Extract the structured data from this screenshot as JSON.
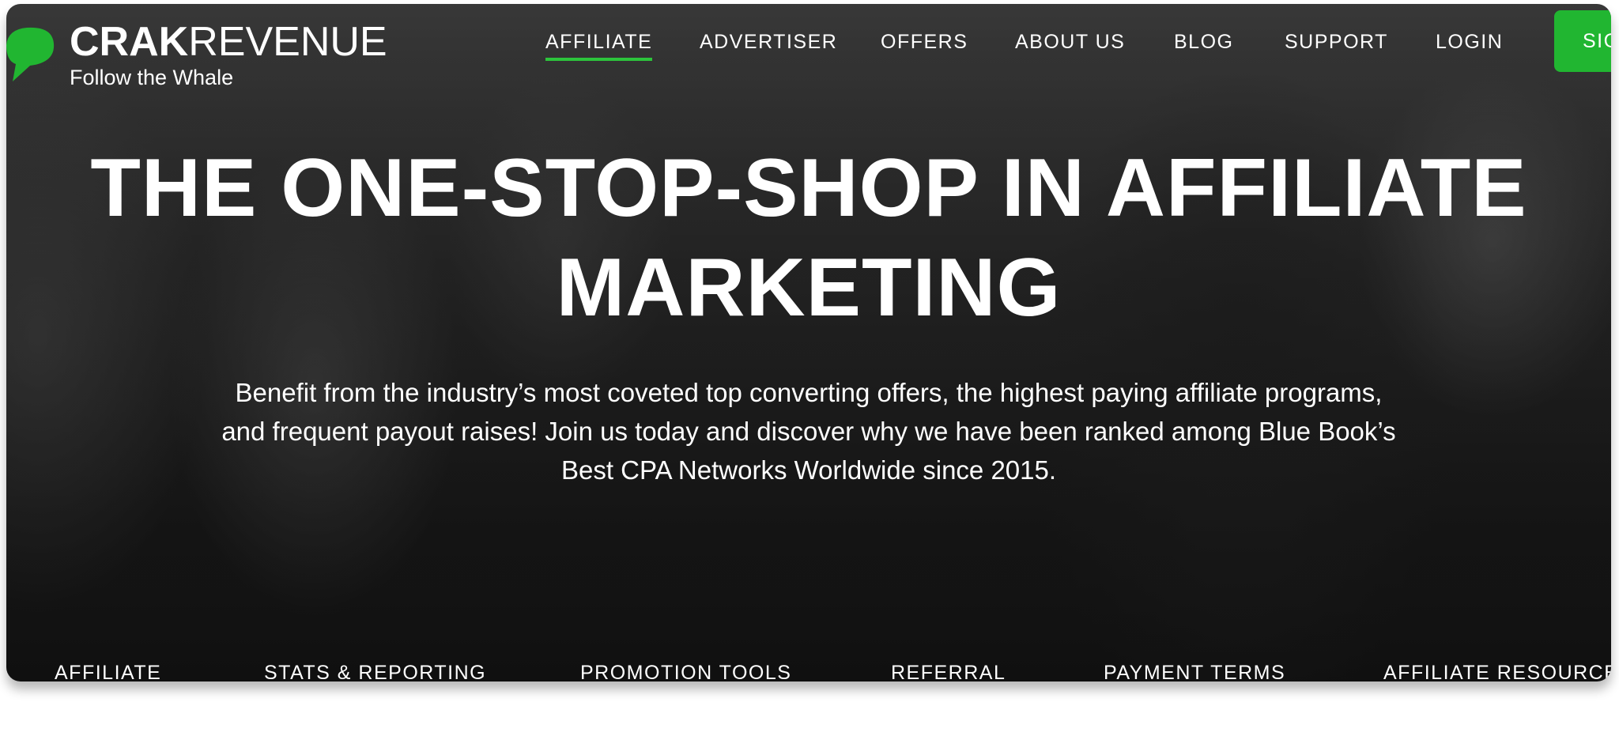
{
  "colors": {
    "accent": "#21b631",
    "active_underline": "#2cc43c",
    "text": "#ffffff",
    "hero_overlay": "#1f1f1f"
  },
  "logo": {
    "icon": "speech-bubble-icon",
    "brand_bold": "CRAK",
    "brand_regular": "REVENUE",
    "tagline": "Follow the Whale"
  },
  "nav": {
    "items": [
      {
        "label": "AFFILIATE",
        "active": true
      },
      {
        "label": "ADVERTISER"
      },
      {
        "label": "OFFERS"
      },
      {
        "label": "ABOUT US"
      },
      {
        "label": "BLOG"
      },
      {
        "label": "SUPPORT"
      },
      {
        "label": "LOGIN"
      }
    ],
    "signup_label": "SIG"
  },
  "hero": {
    "title_line1": "THE ONE-STOP-SHOP IN AFFILIATE",
    "title_line2": "MARKETING",
    "sub_line1": "Benefit from the industry’s most coveted top converting offers, the highest paying affiliate programs,",
    "sub_line2": "and frequent payout raises! Join us today and discover why we have been ranked among Blue Book’s",
    "sub_line3": "Best CPA Networks Worldwide since 2015."
  },
  "subnav": {
    "items": [
      "AFFILIATE",
      "STATS & REPORTING",
      "PROMOTION TOOLS",
      "REFERRAL",
      "PAYMENT TERMS",
      "AFFILIATE RESOURCES"
    ]
  }
}
